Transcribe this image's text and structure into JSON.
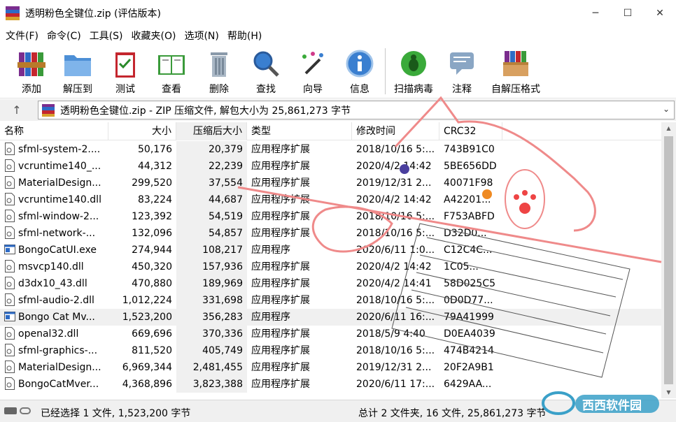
{
  "window": {
    "title": "透明粉色全键位.zip (评估版本)",
    "controls": {
      "minimize": "─",
      "maximize": "☐",
      "close": "✕"
    }
  },
  "menu": [
    "文件(F)",
    "命令(C)",
    "工具(S)",
    "收藏夹(O)",
    "选项(N)",
    "帮助(H)"
  ],
  "toolbar": [
    {
      "label": "添加",
      "icon": "add-archive-icon"
    },
    {
      "label": "解压到",
      "icon": "extract-folder-icon"
    },
    {
      "label": "测试",
      "icon": "test-clipboard-icon"
    },
    {
      "label": "查看",
      "icon": "view-book-icon"
    },
    {
      "label": "删除",
      "icon": "trash-icon"
    },
    {
      "label": "查找",
      "icon": "magnifier-icon"
    },
    {
      "label": "向导",
      "icon": "wizard-wand-icon"
    },
    {
      "label": "信息",
      "icon": "info-icon"
    },
    {
      "label": "扫描病毒",
      "icon": "virus-bug-icon"
    },
    {
      "label": "注释",
      "icon": "comment-icon"
    },
    {
      "label": "自解压格式",
      "icon": "sfx-box-icon"
    }
  ],
  "address": {
    "up": "↑",
    "path": "透明粉色全键位.zip - ZIP 压缩文件, 解包大小为 25,861,273 字节",
    "chevron": "⌄"
  },
  "columns": {
    "name": "名称",
    "size": "大小",
    "packed": "压缩后大小",
    "type": "类型",
    "modified": "修改时间",
    "crc": "CRC32"
  },
  "files": [
    {
      "name": "sfml-system-2....",
      "size": "50,176",
      "packed": "20,379",
      "type": "应用程序扩展",
      "modified": "2018/10/16 5:...",
      "crc": "743B91C0",
      "kind": "dll"
    },
    {
      "name": "vcruntime140_...",
      "size": "44,312",
      "packed": "22,239",
      "type": "应用程序扩展",
      "modified": "2020/4/2 14:42",
      "crc": "5BE656DD",
      "kind": "dll"
    },
    {
      "name": "MaterialDesign...",
      "size": "299,520",
      "packed": "37,554",
      "type": "应用程序扩展",
      "modified": "2019/12/31 2...",
      "crc": "40071F98",
      "kind": "dll"
    },
    {
      "name": "vcruntime140.dll",
      "size": "83,224",
      "packed": "44,687",
      "type": "应用程序扩展",
      "modified": "2020/4/2 14:42",
      "crc": "A42201...",
      "kind": "dll"
    },
    {
      "name": "sfml-window-2...",
      "size": "123,392",
      "packed": "54,519",
      "type": "应用程序扩展",
      "modified": "2018/10/16 5:...",
      "crc": "F753ABFD",
      "kind": "dll"
    },
    {
      "name": "sfml-network-...",
      "size": "132,096",
      "packed": "54,857",
      "type": "应用程序扩展",
      "modified": "2018/10/16 5:...",
      "crc": "D32D0...",
      "kind": "dll"
    },
    {
      "name": "BongoCatUI.exe",
      "size": "274,944",
      "packed": "108,217",
      "type": "应用程序",
      "modified": "2020/6/11 1:0...",
      "crc": "C12C4C...",
      "kind": "exe"
    },
    {
      "name": "msvcp140.dll",
      "size": "450,320",
      "packed": "157,936",
      "type": "应用程序扩展",
      "modified": "2020/4/2 14:42",
      "crc": "1C05...",
      "kind": "dll"
    },
    {
      "name": "d3dx10_43.dll",
      "size": "470,880",
      "packed": "189,969",
      "type": "应用程序扩展",
      "modified": "2020/4/2 14:41",
      "crc": "58D025C5",
      "kind": "dll"
    },
    {
      "name": "sfml-audio-2.dll",
      "size": "1,012,224",
      "packed": "331,698",
      "type": "应用程序扩展",
      "modified": "2018/10/16 5:...",
      "crc": "0D0D77...",
      "kind": "dll"
    },
    {
      "name": "Bongo Cat Mv...",
      "size": "1,523,200",
      "packed": "356,283",
      "type": "应用程序",
      "modified": "2020/6/11 16:...",
      "crc": "79A41999",
      "kind": "exe",
      "selected": true
    },
    {
      "name": "openal32.dll",
      "size": "669,696",
      "packed": "370,336",
      "type": "应用程序扩展",
      "modified": "2018/5/9 4:40",
      "crc": "D0EA4039",
      "kind": "dll"
    },
    {
      "name": "sfml-graphics-...",
      "size": "811,520",
      "packed": "405,749",
      "type": "应用程序扩展",
      "modified": "2018/10/16 5:...",
      "crc": "474B4214",
      "kind": "dll"
    },
    {
      "name": "MaterialDesign...",
      "size": "6,969,344",
      "packed": "2,481,455",
      "type": "应用程序扩展",
      "modified": "2019/12/31 2...",
      "crc": "20F2A9B1",
      "kind": "dll"
    },
    {
      "name": "BongoCatMver...",
      "size": "4,368,896",
      "packed": "3,823,388",
      "type": "应用程序扩展",
      "modified": "2020/6/11 17:...",
      "crc": "6429AA...",
      "kind": "dll"
    }
  ],
  "status": {
    "selected": "已经选择 1 文件, 1,523,200 字节",
    "total": "总计 2 文件夹, 16 文件, 25,861,273 字节"
  },
  "watermark": {
    "text": "西西软件园"
  },
  "colors": {
    "sorted_column": "#f0f0f0",
    "selection": "#f0f0f0",
    "overlay_pink": "#ef8a8a",
    "winrar_red": "#c4262e"
  }
}
